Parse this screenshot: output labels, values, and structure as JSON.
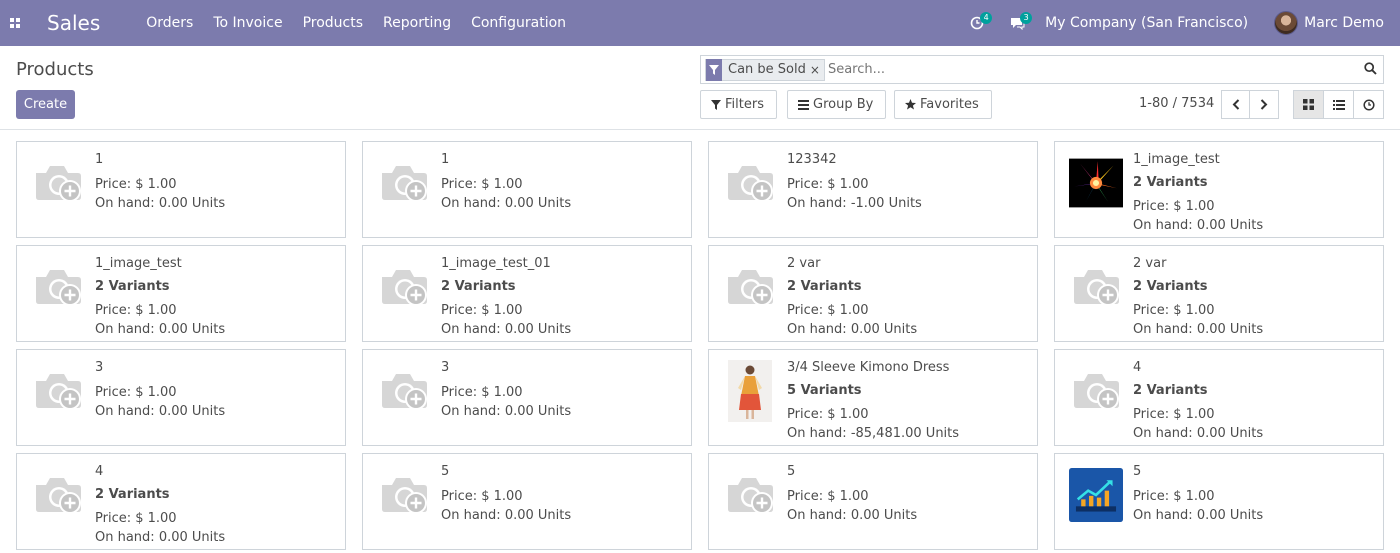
{
  "navbar": {
    "app_name": "Sales",
    "menu": [
      "Orders",
      "To Invoice",
      "Products",
      "Reporting",
      "Configuration"
    ],
    "activity_count": "4",
    "messages_count": "3",
    "company": "My Company (San Francisco)",
    "user": "Marc Demo",
    "bg_color": "#7c7bad"
  },
  "control_panel": {
    "title": "Products",
    "create_label": "Create",
    "search": {
      "facet": "Can be Sold",
      "facet_remove": "×",
      "placeholder": "Search..."
    },
    "filters_label": "Filters",
    "group_by_label": "Group By",
    "favorites_label": "Favorites",
    "pager": "1-80 / 7534",
    "views": [
      "kanban-icon",
      "list-icon",
      "activity-clock-icon"
    ],
    "active_view": "kanban"
  },
  "products": [
    {
      "name": "1",
      "variants": "",
      "price": "Price: $ 1.00",
      "on_hand": "On hand: 0.00 Units",
      "image": "placeholder-camera-icon"
    },
    {
      "name": "1",
      "variants": "",
      "price": "Price: $ 1.00",
      "on_hand": "On hand: 0.00 Units",
      "image": "placeholder-camera-icon"
    },
    {
      "name": "123342",
      "variants": "",
      "price": "Price: $ 1.00",
      "on_hand": "On hand: -1.00 Units",
      "image": "placeholder-camera-icon"
    },
    {
      "name": "1_image_test",
      "variants": "2 Variants",
      "price": "Price: $ 1.00",
      "on_hand": "On hand: 0.00 Units",
      "image": "color-burst-image"
    },
    {
      "name": "1_image_test",
      "variants": "2 Variants",
      "price": "Price: $ 1.00",
      "on_hand": "On hand: 0.00 Units",
      "image": "placeholder-camera-icon"
    },
    {
      "name": "1_image_test_01",
      "variants": "2 Variants",
      "price": "Price: $ 1.00",
      "on_hand": "On hand: 0.00 Units",
      "image": "placeholder-camera-icon"
    },
    {
      "name": "2 var",
      "variants": "2 Variants",
      "price": "Price: $ 1.00",
      "on_hand": "On hand: 0.00 Units",
      "image": "placeholder-camera-icon"
    },
    {
      "name": "2 var",
      "variants": "2 Variants",
      "price": "Price: $ 1.00",
      "on_hand": "On hand: 0.00 Units",
      "image": "placeholder-camera-icon"
    },
    {
      "name": "3",
      "variants": "",
      "price": "Price: $ 1.00",
      "on_hand": "On hand: 0.00 Units",
      "image": "placeholder-camera-icon"
    },
    {
      "name": "3",
      "variants": "",
      "price": "Price: $ 1.00",
      "on_hand": "On hand: 0.00 Units",
      "image": "placeholder-camera-icon"
    },
    {
      "name": "3/4 Sleeve Kimono Dress",
      "variants": "5 Variants",
      "price": "Price: $ 1.00",
      "on_hand": "On hand: -85,481.00 Units",
      "image": "dress-photo-image"
    },
    {
      "name": "4",
      "variants": "2 Variants",
      "price": "Price: $ 1.00",
      "on_hand": "On hand: 0.00 Units",
      "image": "placeholder-camera-icon"
    },
    {
      "name": "4",
      "variants": "2 Variants",
      "price": "Price: $ 1.00",
      "on_hand": "On hand: 0.00 Units",
      "image": "placeholder-camera-icon"
    },
    {
      "name": "5",
      "variants": "",
      "price": "Price: $ 1.00",
      "on_hand": "On hand: 0.00 Units",
      "image": "placeholder-camera-icon"
    },
    {
      "name": "5",
      "variants": "",
      "price": "Price: $ 1.00",
      "on_hand": "On hand: 0.00 Units",
      "image": "placeholder-camera-icon"
    },
    {
      "name": "5",
      "variants": "",
      "price": "Price: $ 1.00",
      "on_hand": "On hand: 0.00 Units",
      "image": "chart-growth-image"
    }
  ]
}
